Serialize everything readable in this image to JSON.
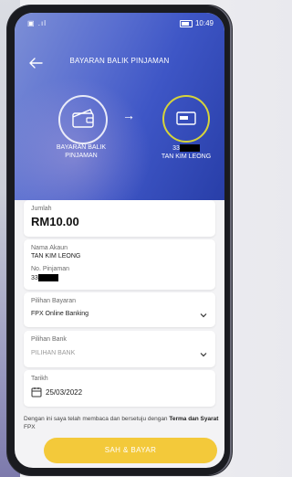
{
  "status": {
    "left": "▣ .ıl",
    "time": "10:49"
  },
  "header": {
    "title": "BAYARAN BALIK PINJAMAN"
  },
  "flow": {
    "from_label": "BAYARAN BALIK PINJAMAN",
    "to_account_prefix": "33",
    "to_name": "TAN KIM LEONG"
  },
  "form": {
    "amount_label": "Jumlah",
    "amount_value": "RM10.00",
    "account_name_label": "Nama Akaun",
    "account_name_value": "TAN KIM LEONG",
    "loan_no_label": "No. Pinjaman",
    "loan_no_prefix": "33",
    "payment_choice_label": "Pilihan Bayaran",
    "payment_choice_value": "FPX Online Banking",
    "bank_choice_label": "Pilihan Bank",
    "bank_choice_placeholder": "PILIHAN BANK",
    "date_label": "Tarikh",
    "date_value": "25/03/2022"
  },
  "terms": {
    "text_before": "Dengan ini saya telah membaca dan bersetuju dengan ",
    "link_text": "Terma dan Syarat",
    "text_after": " FPX"
  },
  "actions": {
    "pay_label": "SAH & BAYAR"
  }
}
